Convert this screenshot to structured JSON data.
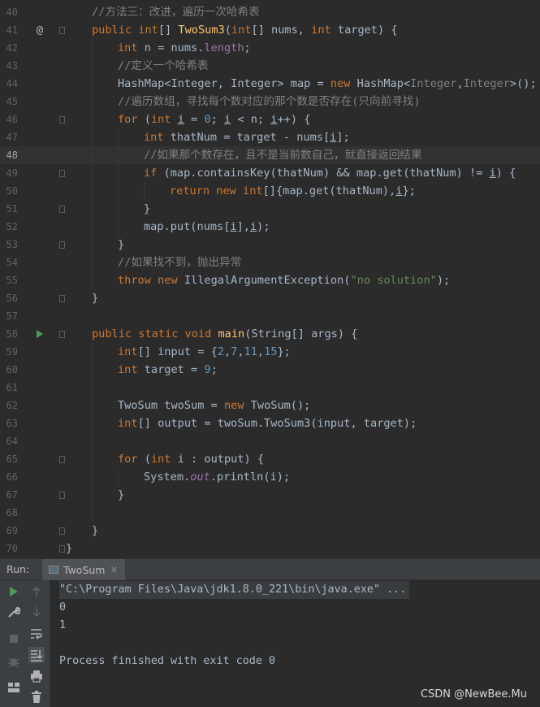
{
  "editor": {
    "lines": [
      {
        "n": "40",
        "segs": [
          [
            "cmt",
            "//方法三：改进，遍历一次哈希表"
          ]
        ],
        "indent": 1
      },
      {
        "n": "41",
        "segs": [
          [
            "kw",
            "public "
          ],
          [
            "kw",
            "int"
          ],
          [
            "",
            "[] "
          ],
          [
            "fn",
            "TwoSum3"
          ],
          [
            "",
            "("
          ],
          [
            "kw",
            "int"
          ],
          [
            "",
            "[] nums, "
          ],
          [
            "kw",
            "int"
          ],
          [
            "",
            " target) {"
          ]
        ],
        "indent": 1,
        "gutter": "@",
        "fold": true
      },
      {
        "n": "42",
        "segs": [
          [
            "kw",
            "int"
          ],
          [
            "",
            " n = nums."
          ],
          [
            "fld",
            "length"
          ],
          [
            "",
            ";"
          ]
        ],
        "indent": 2
      },
      {
        "n": "43",
        "segs": [
          [
            "cmt",
            "//定义一个哈希表"
          ]
        ],
        "indent": 2
      },
      {
        "n": "44",
        "segs": [
          [
            "",
            "HashMap<Integer, Integer> map = "
          ],
          [
            "kw",
            "new "
          ],
          [
            "",
            "HashMap<"
          ],
          [
            "gen",
            "Integer"
          ],
          [
            "",
            ","
          ],
          [
            "gen",
            "Integer"
          ],
          [
            "",
            ">();"
          ]
        ],
        "indent": 2
      },
      {
        "n": "45",
        "segs": [
          [
            "cmt",
            "//遍历数组，寻找每个数对应的那个数是否存在(只向前寻找)"
          ]
        ],
        "indent": 2
      },
      {
        "n": "46",
        "segs": [
          [
            "kw",
            "for "
          ],
          [
            "",
            "("
          ],
          [
            "kw",
            "int "
          ],
          [
            "ul",
            "i"
          ],
          [
            "",
            " = "
          ],
          [
            "num",
            "0"
          ],
          [
            "",
            "; "
          ],
          [
            "ul",
            "i"
          ],
          [
            "",
            " < n; "
          ],
          [
            "ul",
            "i"
          ],
          [
            "",
            "++) {"
          ]
        ],
        "indent": 2,
        "fold": true
      },
      {
        "n": "47",
        "segs": [
          [
            "kw",
            "int"
          ],
          [
            "",
            " thatNum = target - nums["
          ],
          [
            "ul",
            "i"
          ],
          [
            "",
            "];"
          ]
        ],
        "indent": 3
      },
      {
        "n": "48",
        "segs": [
          [
            "cmt",
            "//如果那个数存在，且不是当前数自己，就直接返回结果"
          ]
        ],
        "indent": 3,
        "current": true
      },
      {
        "n": "49",
        "segs": [
          [
            "kw",
            "if "
          ],
          [
            "",
            "(map.containsKey(thatNum) && map.get(thatNum) != "
          ],
          [
            "ul",
            "i"
          ],
          [
            "",
            ") {"
          ]
        ],
        "indent": 3,
        "fold": true
      },
      {
        "n": "50",
        "segs": [
          [
            "kw",
            "return new "
          ],
          [
            "kw",
            "int"
          ],
          [
            "",
            "[]{map.get(thatNum),"
          ],
          [
            "ul",
            "i"
          ],
          [
            "",
            "};"
          ]
        ],
        "indent": 4
      },
      {
        "n": "51",
        "segs": [
          [
            "",
            "}"
          ]
        ],
        "indent": 3,
        "fold": true
      },
      {
        "n": "52",
        "segs": [
          [
            "",
            "map.put(nums["
          ],
          [
            "ul",
            "i"
          ],
          [
            "",
            "],"
          ],
          [
            "ul",
            "i"
          ],
          [
            "",
            ");"
          ]
        ],
        "indent": 3
      },
      {
        "n": "53",
        "segs": [
          [
            "",
            "}"
          ]
        ],
        "indent": 2,
        "fold": true
      },
      {
        "n": "54",
        "segs": [
          [
            "cmt",
            "//如果找不到，抛出异常"
          ]
        ],
        "indent": 2
      },
      {
        "n": "55",
        "segs": [
          [
            "kw",
            "throw new "
          ],
          [
            "",
            "IllegalArgumentException("
          ],
          [
            "str",
            "\"no solution\""
          ],
          [
            "",
            ");"
          ]
        ],
        "indent": 2
      },
      {
        "n": "56",
        "segs": [
          [
            "",
            "}"
          ]
        ],
        "indent": 1,
        "fold": true
      },
      {
        "n": "57",
        "segs": [],
        "indent": 1
      },
      {
        "n": "58",
        "segs": [
          [
            "kw",
            "public static void "
          ],
          [
            "fn",
            "main"
          ],
          [
            "",
            "(String[] args) {"
          ]
        ],
        "indent": 1,
        "gutter": "run",
        "fold": true
      },
      {
        "n": "59",
        "segs": [
          [
            "kw",
            "int"
          ],
          [
            "",
            "[] input = {"
          ],
          [
            "num",
            "2"
          ],
          [
            "",
            ","
          ],
          [
            "num",
            "7"
          ],
          [
            "",
            ","
          ],
          [
            "num",
            "11"
          ],
          [
            "",
            ","
          ],
          [
            "num",
            "15"
          ],
          [
            "",
            "};"
          ]
        ],
        "indent": 2
      },
      {
        "n": "60",
        "segs": [
          [
            "kw",
            "int"
          ],
          [
            "",
            " target = "
          ],
          [
            "num",
            "9"
          ],
          [
            "",
            ";"
          ]
        ],
        "indent": 2
      },
      {
        "n": "61",
        "segs": [],
        "indent": 2
      },
      {
        "n": "62",
        "segs": [
          [
            "",
            "TwoSum twoSum = "
          ],
          [
            "kw",
            "new "
          ],
          [
            "",
            "TwoSum();"
          ]
        ],
        "indent": 2
      },
      {
        "n": "63",
        "segs": [
          [
            "kw",
            "int"
          ],
          [
            "",
            "[] output = twoSum.TwoSum3(input, target);"
          ]
        ],
        "indent": 2
      },
      {
        "n": "64",
        "segs": [],
        "indent": 2
      },
      {
        "n": "65",
        "segs": [
          [
            "kw",
            "for "
          ],
          [
            "",
            "("
          ],
          [
            "kw",
            "int "
          ],
          [
            "",
            "i : output) {"
          ]
        ],
        "indent": 2,
        "fold": true
      },
      {
        "n": "66",
        "segs": [
          [
            "",
            "System."
          ],
          [
            "ital",
            "out"
          ],
          [
            "",
            ".println(i);"
          ]
        ],
        "indent": 3
      },
      {
        "n": "67",
        "segs": [
          [
            "",
            "}"
          ]
        ],
        "indent": 2,
        "fold": true
      },
      {
        "n": "68",
        "segs": [],
        "indent": 2
      },
      {
        "n": "69",
        "segs": [
          [
            "",
            "}"
          ]
        ],
        "indent": 1,
        "fold": true
      },
      {
        "n": "70",
        "segs": [
          [
            "",
            "}"
          ]
        ],
        "indent": 0,
        "fold": true
      }
    ]
  },
  "run_panel": {
    "label": "Run:",
    "tab_label": "TwoSum",
    "tab_close": "×",
    "console_lines": [
      {
        "text": "\"C:\\Program Files\\Java\\jdk1.8.0_221\\bin\\java.exe\" ...",
        "cmd": true
      },
      {
        "text": "0"
      },
      {
        "text": "1"
      },
      {
        "text": ""
      },
      {
        "text": "Process finished with exit code 0"
      }
    ]
  },
  "watermark": "CSDN @NewBee.Mu",
  "colors": {
    "keyword": "#cc7832",
    "function": "#ffc66d",
    "number": "#6897bb",
    "string": "#6a8759",
    "comment": "#808080",
    "field": "#9876aa",
    "run": "#499c54"
  }
}
